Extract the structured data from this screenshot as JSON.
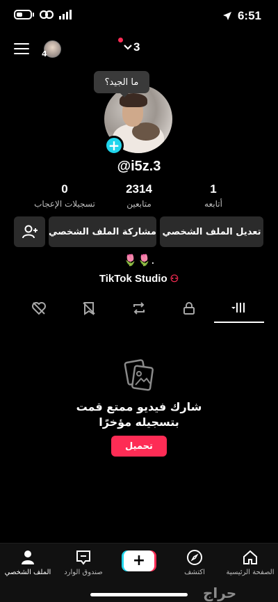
{
  "status_bar": {
    "time": "6:51"
  },
  "top_bar": {
    "account_count": "4",
    "switch_count": "3"
  },
  "profile": {
    "bubble_text": "ما الجيد؟",
    "username": "@i5z.3",
    "stats": [
      {
        "value": "1",
        "label": "أتابعه"
      },
      {
        "value": "2314",
        "label": "متابعين"
      },
      {
        "value": "0",
        "label": "تسجيلات الإعجاب"
      }
    ],
    "edit_label": "تعديل الملف الشخصي",
    "share_label": "مشاركة الملف الشخصي",
    "bio": "🌷🌷.",
    "studio_label": "TikTok Studio"
  },
  "empty_state": {
    "title_line1": "شارك فيديو ممتع قمت",
    "title_line2": "بتسجيله مؤخرًا",
    "upload_label": "تحميل"
  },
  "bottom_nav": {
    "home": "الصفحة الرئيسية",
    "discover": "اكتشف",
    "inbox": "صندوق الوارد",
    "profile": "الملف الشخصي"
  },
  "watermark": "حراج",
  "colors": {
    "accent": "#fe2c55",
    "cyan": "#20d5ec"
  }
}
